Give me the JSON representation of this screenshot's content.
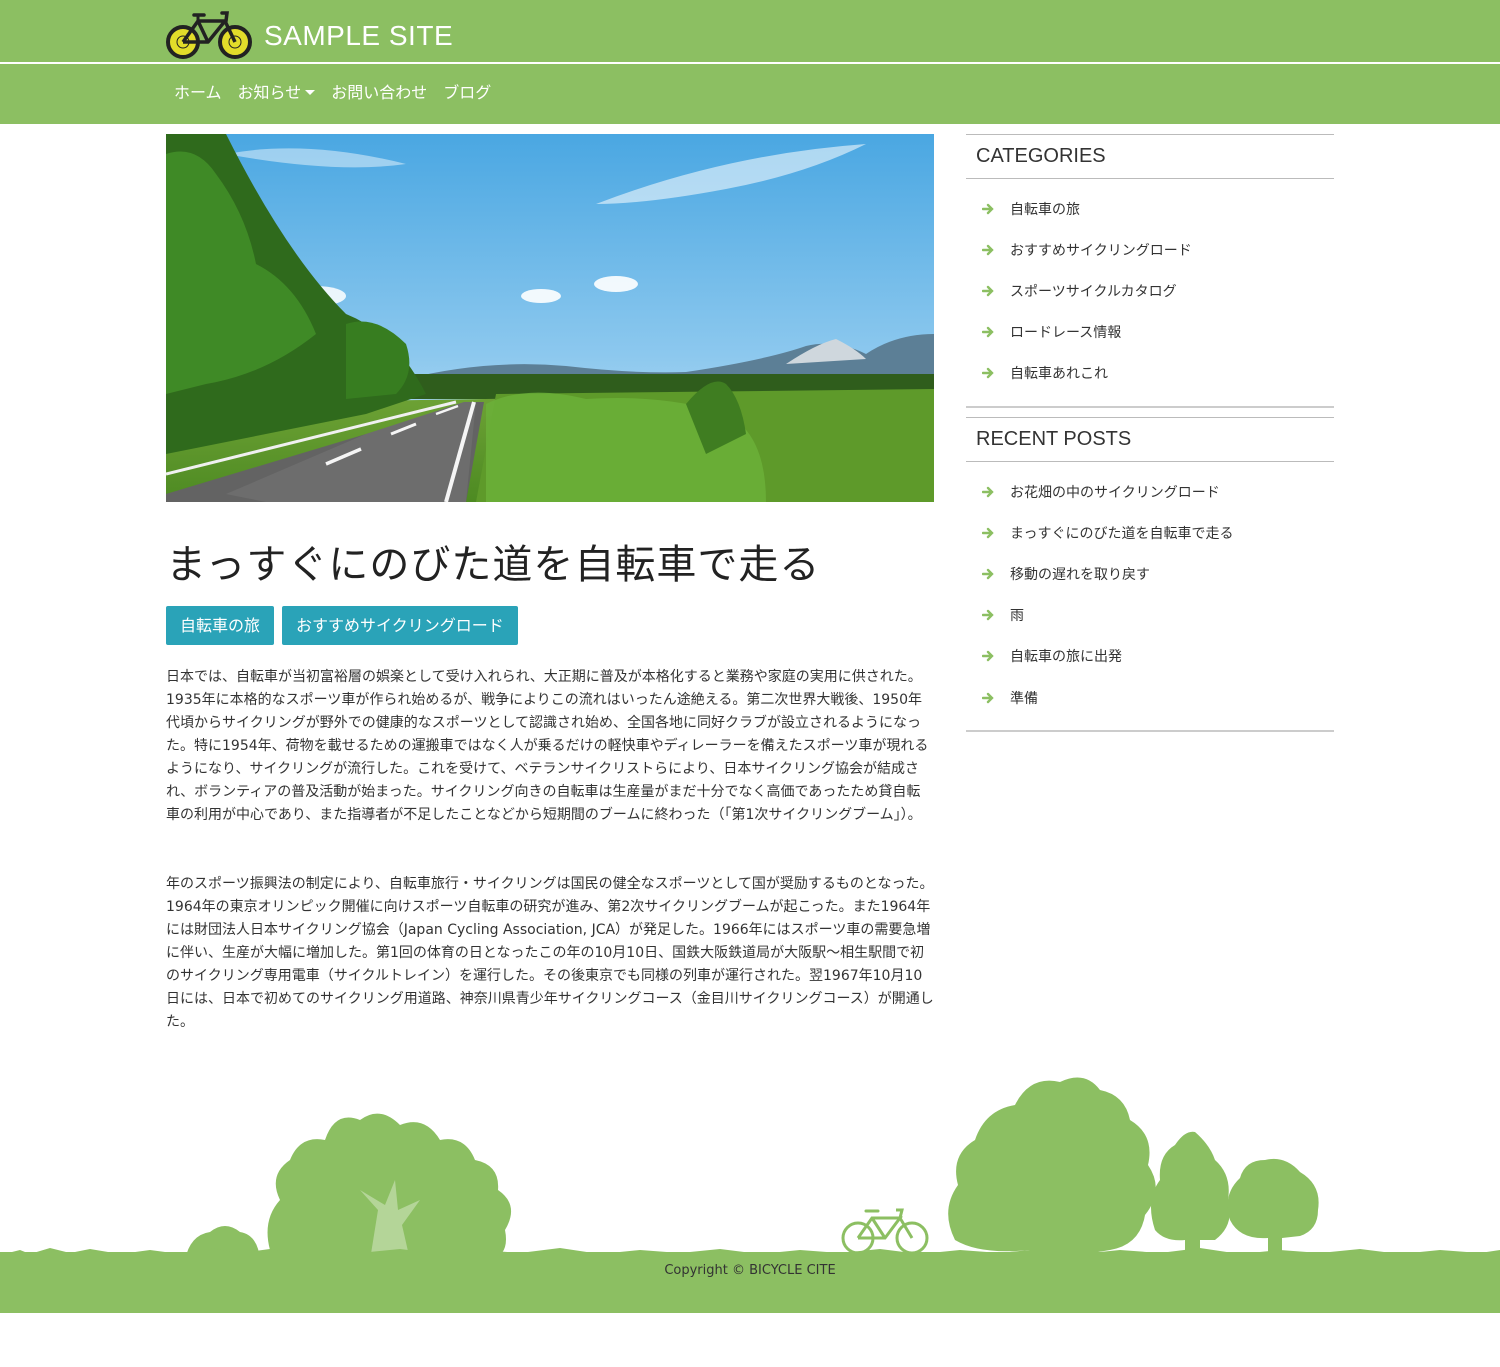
{
  "header": {
    "site_title": "SAMPLE SITE",
    "nav": [
      {
        "label": "ホーム"
      },
      {
        "label": "お知らせ",
        "dropdown": true
      },
      {
        "label": "お問い合わせ"
      },
      {
        "label": "ブログ"
      }
    ]
  },
  "post": {
    "title": "まっすぐにのびた道を自転車で走る",
    "tags": [
      "自転車の旅",
      "おすすめサイクリングロード"
    ],
    "paragraphs": [
      "日本では、自転車が当初富裕層の娯楽として受け入れられ、大正期に普及が本格化すると業務や家庭の実用に供された。1935年に本格的なスポーツ車が作られ始めるが、戦争によりこの流れはいったん途絶える。第二次世界大戦後、1950年代頃からサイクリングが野外での健康的なスポーツとして認識され始め、全国各地に同好クラブが設立されるようになった。特に1954年、荷物を載せるための運搬車ではなく人が乗るだけの軽快車やディレーラーを備えたスポーツ車が現れるようになり、サイクリングが流行した。これを受けて、ベテランサイクリストらにより、日本サイクリング協会が結成され、ボランティアの普及活動が始まった。サイクリング向きの自転車は生産量がまだ十分でなく高価であったため貸自転車の利用が中心であり、また指導者が不足したことなどから短期間のブームに終わった（「第1次サイクリングブーム」）。",
      "年のスポーツ振興法の制定により、自転車旅行・サイクリングは国民の健全なスポーツとして国が奨励するものとなった。1964年の東京オリンピック開催に向けスポーツ自転車の研究が進み、第2次サイクリングブームが起こった。また1964年には財団法人日本サイクリング協会（Japan Cycling Association, JCA）が発足した。1966年にはスポーツ車の需要急増に伴い、生産が大幅に増加した。第1回の体育の日となったこの年の10月10日、国鉄大阪鉄道局が大阪駅〜相生駅間で初のサイクリング専用電車（サイクルトレイン）を運行した。その後東京でも同様の列車が運行された。翌1967年10月10日には、日本で初めてのサイクリング用道路、神奈川県青少年サイクリングコース（金目川サイクリングコース）が開通した。"
    ]
  },
  "sidebar": {
    "categories": {
      "title": "CATEGORIES",
      "items": [
        "自転車の旅",
        "おすすめサイクリングロード",
        "スポーツサイクルカタログ",
        "ロードレース情報",
        "自転車あれこれ"
      ]
    },
    "recent_posts": {
      "title": "RECENT POSTS",
      "items": [
        "お花畑の中のサイクリングロード",
        "まっすぐにのびた道を自転車で走る",
        "移動の遅れを取り戻す",
        "雨",
        "自転車の旅に出発",
        "準備"
      ]
    }
  },
  "footer": {
    "copyright": "Copyright © BICYCLE CITE"
  },
  "colors": {
    "brand_green": "#8cbf62",
    "tag_teal": "#2aa3b8",
    "arrow_green": "#8cbf62"
  },
  "icons": {
    "logo": "bicycle-icon",
    "list_bullet": "arrow-right-icon",
    "nav_dropdown": "caret-down-icon"
  }
}
